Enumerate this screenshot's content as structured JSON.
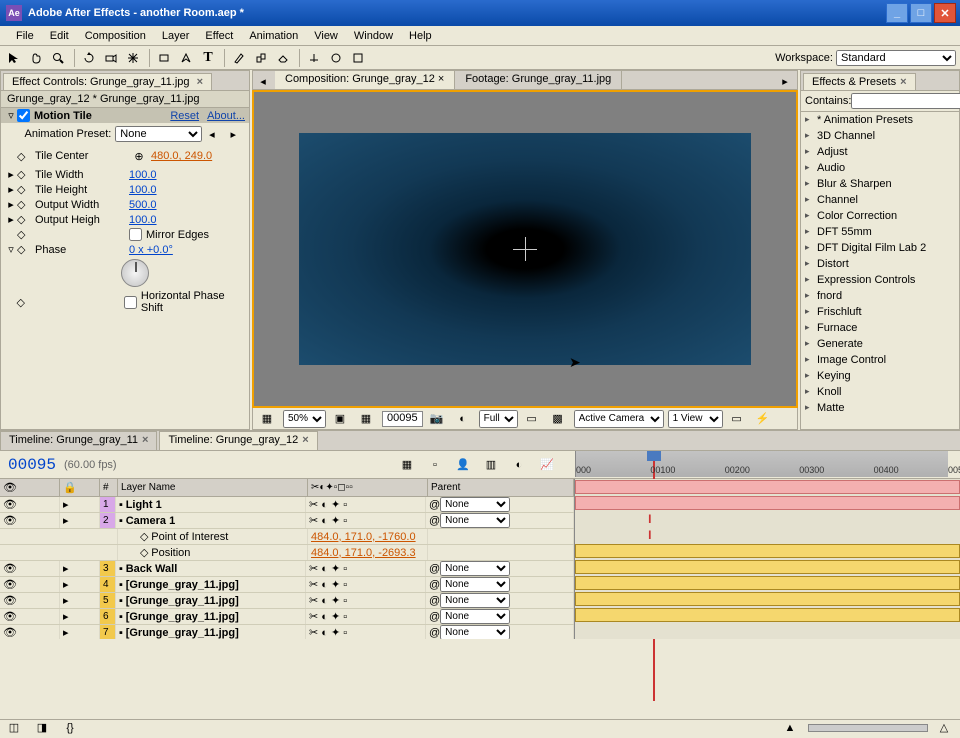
{
  "window": {
    "app_label": "Ae",
    "title": "Adobe After Effects - another Room.aep *"
  },
  "menu": [
    "File",
    "Edit",
    "Composition",
    "Layer",
    "Effect",
    "Animation",
    "View",
    "Window",
    "Help"
  ],
  "workspace": {
    "label": "Workspace:",
    "value": "Standard"
  },
  "effect_controls": {
    "tab": "Effect Controls: Grunge_gray_11.jpg",
    "breadcrumb": "Grunge_gray_12 * Grunge_gray_11.jpg",
    "effect_name": "Motion Tile",
    "reset": "Reset",
    "about": "About...",
    "preset_label": "Animation Preset:",
    "preset_value": "None",
    "params": {
      "tile_center": {
        "label": "Tile Center",
        "value": "480.0, 249.0"
      },
      "tile_width": {
        "label": "Tile Width",
        "value": "100.0"
      },
      "tile_height": {
        "label": "Tile Height",
        "value": "100.0"
      },
      "output_width": {
        "label": "Output Width",
        "value": "500.0"
      },
      "output_height": {
        "label": "Output Heigh",
        "value": "100.0"
      },
      "mirror": {
        "label": "Mirror Edges"
      },
      "phase": {
        "label": "Phase",
        "value": "0 x +0.0°"
      },
      "hshift": {
        "label": "Horizontal Phase Shift"
      }
    }
  },
  "composition": {
    "tab_active": "Composition: Grunge_gray_12",
    "tab_inactive": "Footage: Grunge_gray_11.jpg",
    "zoom": "50%",
    "frame": "00095",
    "resolution": "Full",
    "camera": "Active Camera",
    "view": "1 View"
  },
  "effects_panel": {
    "title": "Effects & Presets",
    "contains_label": "Contains:",
    "categories": [
      "* Animation Presets",
      "3D Channel",
      "Adjust",
      "Audio",
      "Blur & Sharpen",
      "Channel",
      "Color Correction",
      "DFT 55mm",
      "DFT Digital Film Lab 2",
      "Distort",
      "Expression Controls",
      "fnord",
      "Frischluft",
      "Furnace",
      "Generate",
      "Image Control",
      "Keying",
      "Knoll",
      "Matte"
    ]
  },
  "timeline": {
    "tabs": [
      "Timeline: Grunge_gray_11",
      "Timeline: Grunge_gray_12"
    ],
    "timecode": "00095",
    "fps": "(60.00 fps)",
    "col_num": "#",
    "col_layer": "Layer Name",
    "col_parent": "Parent",
    "parent_none": "None",
    "ruler_ticks": [
      "000",
      "00100",
      "00200",
      "00300",
      "00400",
      "0050"
    ],
    "playhead_pct": 19,
    "layers": [
      {
        "num": "1",
        "color": "purple",
        "name": "Light 1",
        "bar": "pink",
        "parent": true,
        "props": []
      },
      {
        "num": "2",
        "color": "purple",
        "name": "Camera 1",
        "bar": "pink",
        "parent": true,
        "props": [
          {
            "label": "Point of Interest",
            "value": "484.0, 171.0, -1760.0"
          },
          {
            "label": "Position",
            "value": "484.0, 171.0, -2693.3"
          }
        ]
      },
      {
        "num": "3",
        "color": "yellow",
        "name": "Back Wall",
        "bar": "yellow",
        "parent": true,
        "props": []
      },
      {
        "num": "4",
        "color": "yellow",
        "name": "[Grunge_gray_11.jpg]",
        "bar": "yellow",
        "parent": true,
        "props": []
      },
      {
        "num": "5",
        "color": "yellow",
        "name": "[Grunge_gray_11.jpg]",
        "bar": "yellow",
        "parent": true,
        "props": []
      },
      {
        "num": "6",
        "color": "yellow",
        "name": "[Grunge_gray_11.jpg]",
        "bar": "yellow",
        "parent": true,
        "props": []
      },
      {
        "num": "7",
        "color": "yellow",
        "name": "[Grunge_gray_11.jpg]",
        "bar": "yellow",
        "parent": true,
        "props": []
      }
    ]
  }
}
